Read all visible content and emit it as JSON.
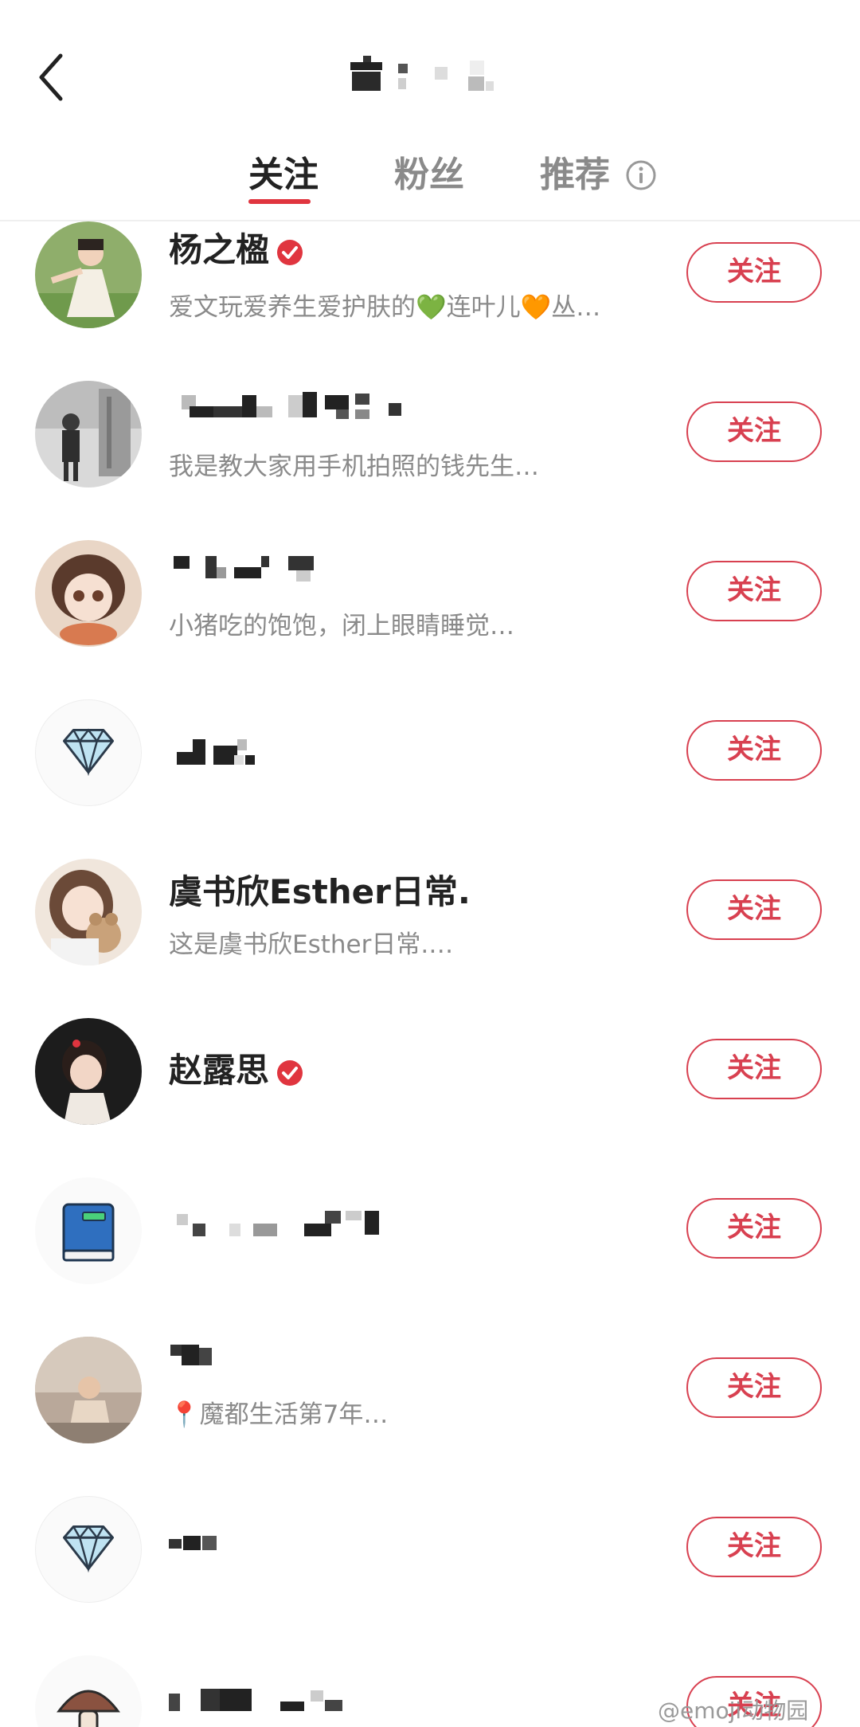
{
  "header": {
    "back_icon": "chevron-left-icon",
    "tabs": [
      {
        "label": "关注",
        "active": true
      },
      {
        "label": "粉丝",
        "active": false
      },
      {
        "label": "推荐",
        "active": false
      }
    ],
    "info_icon": "info-circle-icon"
  },
  "colors": {
    "accent": "#e0353f",
    "follow_border": "#d84050",
    "secondary_text": "#8a8a8a"
  },
  "users": [
    {
      "name": "杨之楹",
      "verified": true,
      "desc": "爱文玩爱养生爱护肤的💚连叶儿🧡丛…",
      "button": "关注"
    },
    {
      "name": "",
      "verified": false,
      "desc": "我是教大家用手机拍照的钱先生…",
      "button": "关注"
    },
    {
      "name": "",
      "verified": false,
      "desc": "小猪吃的饱饱，闭上眼睛睡觉…",
      "button": "关注"
    },
    {
      "name": "",
      "verified": false,
      "desc": "",
      "button": "关注",
      "avatar_icon": "diamond-icon"
    },
    {
      "name": "虞书欣Esther日常.",
      "verified": false,
      "desc": "这是虞书欣Esther日常.…",
      "button": "关注"
    },
    {
      "name": "赵露思",
      "verified": true,
      "desc": "",
      "button": "关注"
    },
    {
      "name": "",
      "verified": false,
      "desc": "",
      "button": "关注",
      "avatar_icon": "book-icon"
    },
    {
      "name": "",
      "verified": false,
      "desc": "📍魔都生活第7年…",
      "button": "关注"
    },
    {
      "name": "",
      "verified": false,
      "desc": "",
      "button": "关注",
      "avatar_icon": "diamond-icon"
    },
    {
      "name": "",
      "verified": false,
      "desc": "",
      "button": "关注",
      "avatar_icon": "mushroom-icon"
    }
  ],
  "watermark": "@emoji动物园"
}
